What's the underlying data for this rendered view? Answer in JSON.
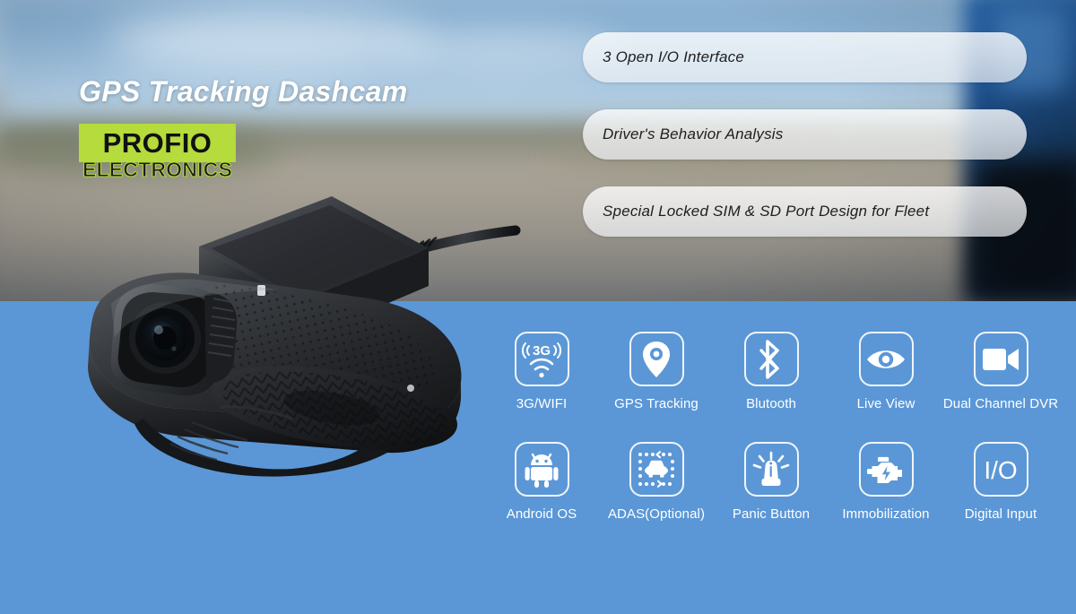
{
  "hero": {
    "title": "GPS Tracking Dashcam",
    "logo_word": "PROFIO",
    "logo_sub": "ELECTRONICS",
    "logo_bg_color": "#b5db3c",
    "product_name": "dashcam-product-render"
  },
  "colors": {
    "panel_blue": "#5b97d6",
    "logo_green": "#b5db3c",
    "pill_text": "#1e1e1e",
    "label_white": "#ffffff"
  },
  "features": [
    {
      "label": "3 Open I/O Interface"
    },
    {
      "label": "Driver's Behavior Analysis"
    },
    {
      "label": "Special Locked SIM & SD Port Design for Fleet"
    }
  ],
  "icon_rows": [
    [
      {
        "label": "3G/WIFI",
        "icon": "3g-wifi-icon"
      },
      {
        "label": "GPS Tracking",
        "icon": "map-pin-icon"
      },
      {
        "label": "Blutooth",
        "icon": "bluetooth-icon"
      },
      {
        "label": "Live View",
        "icon": "eye-icon"
      },
      {
        "label": "Dual Channel DVR",
        "icon": "video-camera-icon"
      }
    ],
    [
      {
        "label": "Android OS",
        "icon": "android-robot-icon"
      },
      {
        "label": "ADAS(Optional)",
        "icon": "adas-car-icon"
      },
      {
        "label": "Panic Button",
        "icon": "siren-beacon-icon"
      },
      {
        "label": "Immobilization",
        "icon": "engine-bolt-icon"
      },
      {
        "label": "Digital Input",
        "icon": "io-text-icon"
      }
    ]
  ],
  "icon_glyph_text": {
    "three_g": "3G",
    "io": "I/O"
  }
}
